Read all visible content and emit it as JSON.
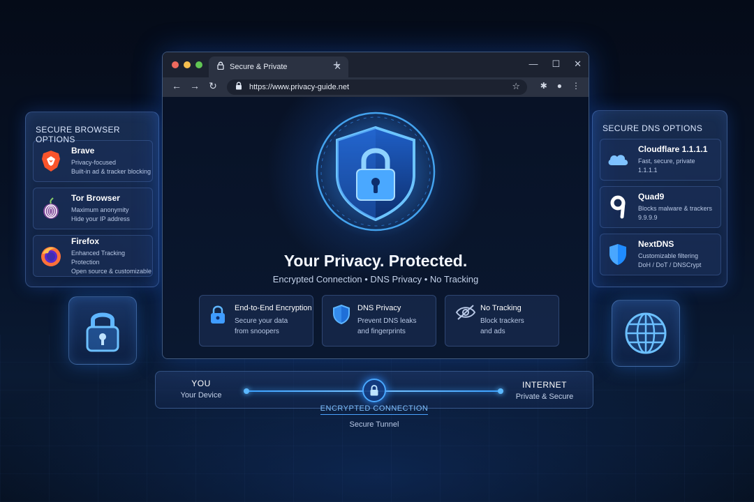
{
  "browser": {
    "tab_title": "Secure & Private",
    "url": "https://www.privacy-guide.net"
  },
  "hero": {
    "title": "Your Privacy. Protected.",
    "subtitle": "Encrypted Connection  •  DNS Privacy  •  No Tracking"
  },
  "features": [
    {
      "icon": "lock-icon",
      "name": "End-to-End Encryption",
      "line1": "Secure your data",
      "line2": "from snoopers"
    },
    {
      "icon": "shield-icon",
      "name": "DNS Privacy",
      "line1": "Prevent DNS leaks",
      "line2": "and fingerprints"
    },
    {
      "icon": "eye-slash-icon",
      "name": "No Tracking",
      "line1": "Block trackers",
      "line2": "and ads"
    }
  ],
  "browser_options": {
    "title": "SECURE BROWSER OPTIONS",
    "items": [
      {
        "icon": "brave-icon",
        "name": "Brave",
        "line1": "Privacy-focused",
        "line2": "Built-in ad & tracker blocking"
      },
      {
        "icon": "tor-icon",
        "name": "Tor Browser",
        "line1": "Maximum anonymity",
        "line2": "Hide your IP address"
      },
      {
        "icon": "firefox-icon",
        "name": "Firefox",
        "line1": "Enhanced Tracking Protection",
        "line2": "Open source & customizable"
      }
    ]
  },
  "dns_options": {
    "title": "SECURE DNS OPTIONS",
    "items": [
      {
        "icon": "cloudflare-icon",
        "name": "Cloudflare 1.1.1.1",
        "line1": "Fast, secure, private",
        "line2": "1.1.1.1"
      },
      {
        "icon": "quad9-icon",
        "name": "Quad9",
        "line1": "Blocks malware & trackers",
        "line2": "9.9.9.9"
      },
      {
        "icon": "nextdns-icon",
        "name": "NextDNS",
        "line1": "Customizable filtering",
        "line2": "DoH / DoT / DNSCrypt"
      }
    ]
  },
  "connection": {
    "left_title": "YOU",
    "left_sub": "Your Device",
    "right_title": "INTERNET",
    "right_sub": "Private & Secure",
    "label": "ENCRYPTED CONNECTION",
    "sublabel": "Secure Tunnel"
  },
  "colors": {
    "accent": "#3aa0ff",
    "background": "#071226",
    "close_dot": "#ed6a5e",
    "minimize_dot": "#f5bf4f",
    "maximize_dot": "#61c554"
  }
}
